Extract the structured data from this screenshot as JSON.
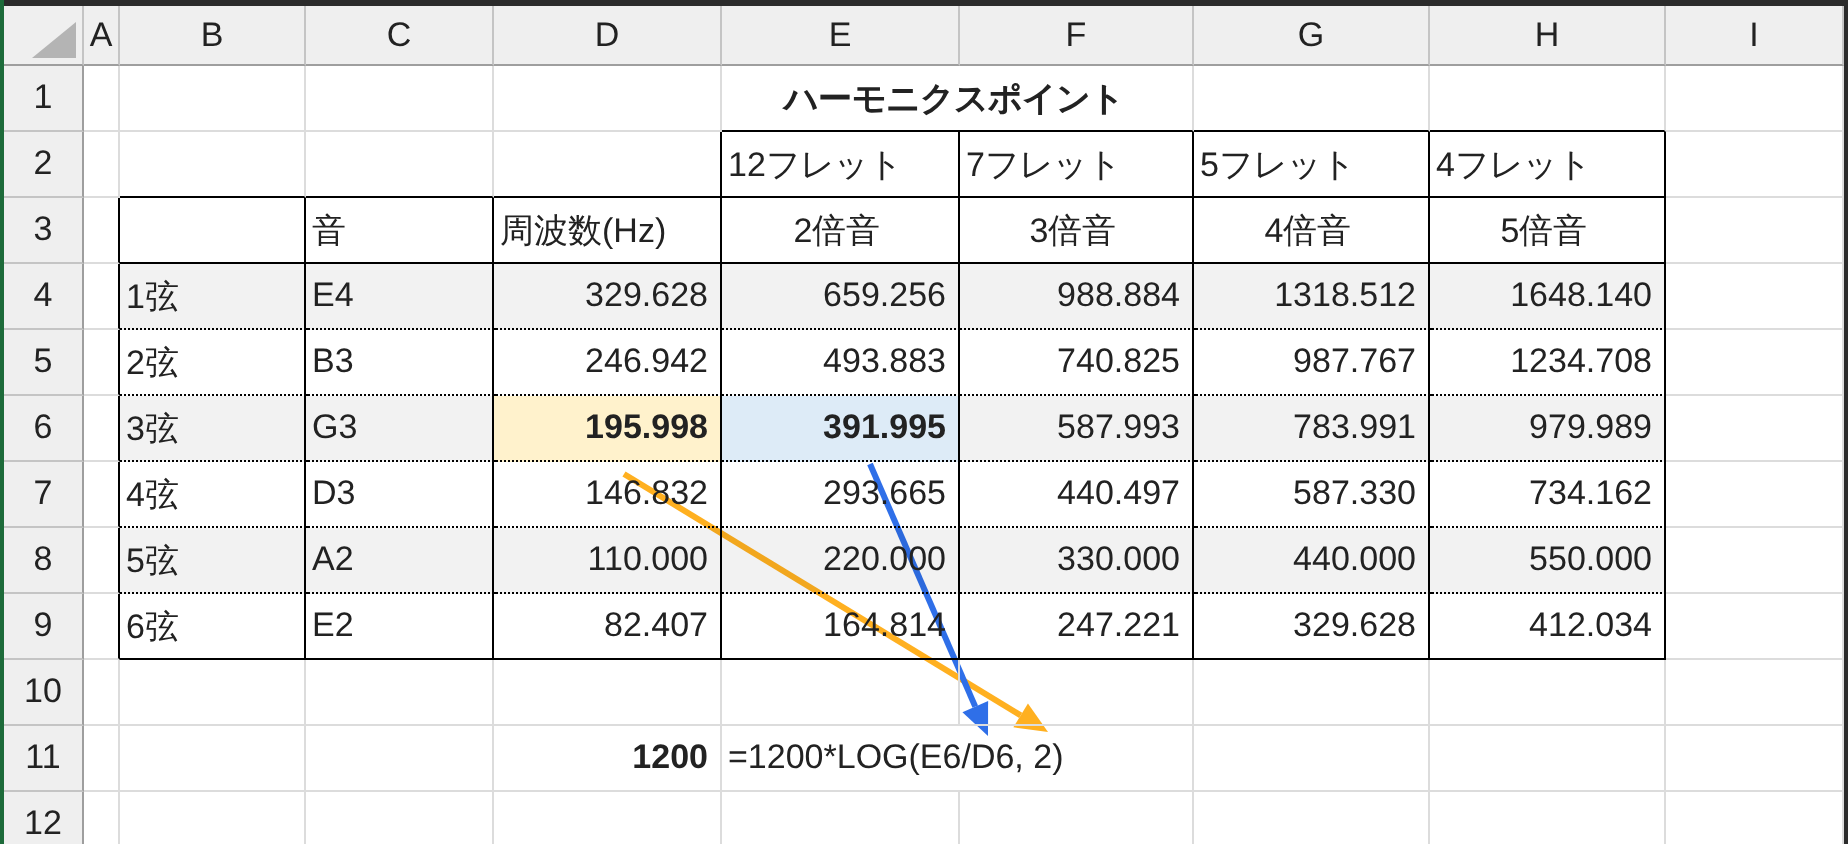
{
  "columns": [
    "A",
    "B",
    "C",
    "D",
    "E",
    "F",
    "G",
    "H",
    "I"
  ],
  "row_numbers": [
    "1",
    "2",
    "3",
    "4",
    "5",
    "6",
    "7",
    "8",
    "9",
    "10",
    "11",
    "12"
  ],
  "title": "ハーモニクスポイント",
  "fret_headers": [
    "12フレット",
    "7フレット",
    "5フレット",
    "4フレット"
  ],
  "table_headers": [
    "音",
    "周波数(Hz)",
    "2倍音",
    "3倍音",
    "4倍音",
    "5倍音"
  ],
  "rows": [
    {
      "string": "1弦",
      "note": "E4",
      "shaded": true,
      "traced": false,
      "values": [
        "329.628",
        "659.256",
        "988.884",
        "1318.512",
        "1648.140"
      ]
    },
    {
      "string": "2弦",
      "note": "B3",
      "shaded": false,
      "traced": false,
      "values": [
        "246.942",
        "493.883",
        "740.825",
        "987.767",
        "1234.708"
      ]
    },
    {
      "string": "3弦",
      "note": "G3",
      "shaded": true,
      "traced": true,
      "values": [
        "195.998",
        "391.995",
        "587.993",
        "783.991",
        "979.989"
      ]
    },
    {
      "string": "4弦",
      "note": "D3",
      "shaded": false,
      "traced": false,
      "values": [
        "146.832",
        "293.665",
        "440.497",
        "587.330",
        "734.162"
      ]
    },
    {
      "string": "5弦",
      "note": "A2",
      "shaded": true,
      "traced": false,
      "values": [
        "110.000",
        "220.000",
        "330.000",
        "440.000",
        "550.000"
      ]
    },
    {
      "string": "6弦",
      "note": "E2",
      "shaded": false,
      "traced": false,
      "values": [
        "82.407",
        "164.814",
        "247.221",
        "329.628",
        "412.034"
      ]
    }
  ],
  "formula_row": {
    "result": "1200",
    "formula": "=1200*LOG(E6/D6, 2)"
  },
  "trace_arrows": [
    {
      "color": "#ffb020"
    },
    {
      "color": "#2f6fe8"
    }
  ]
}
